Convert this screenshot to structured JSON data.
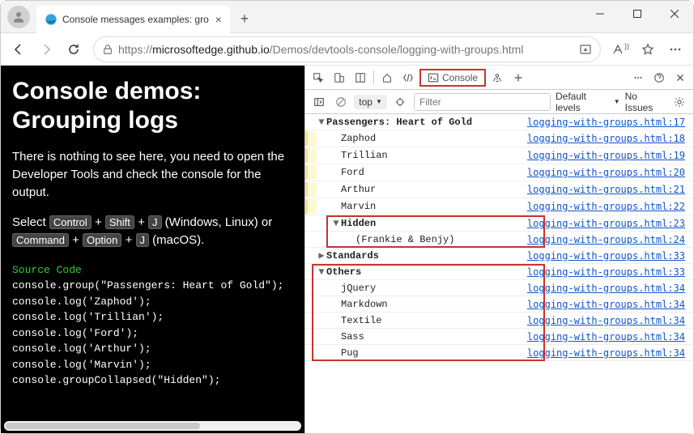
{
  "tab": {
    "title": "Console messages examples: gro"
  },
  "url": {
    "prefix": "https://",
    "host": "microsoftedge.github.io",
    "path": "/Demos/devtools-console/logging-with-groups.html"
  },
  "page": {
    "heading": "Console demos: Grouping logs",
    "p1": "There is nothing to see here, you need to open the Developer Tools and check the console for the output.",
    "p2a": "Select ",
    "p2b": " (Windows, Linux) or ",
    "p2c": " (macOS).",
    "k1": "Control",
    "k2": "Shift",
    "k3": "J",
    "k4": "Command",
    "k5": "Option",
    "k6": "J",
    "plus": "+",
    "srcLabel": "Source Code",
    "code": [
      "console.group(\"Passengers: Heart of Gold\");",
      "console.log('Zaphod');",
      "console.log('Trillian');",
      "console.log('Ford');",
      "console.log('Arthur');",
      "console.log('Marvin');",
      "console.groupCollapsed(\"Hidden\");"
    ]
  },
  "devtools": {
    "consoleTab": "Console",
    "context": "top",
    "filterPlaceholder": "Filter",
    "levels": "Default levels",
    "noIssues": "No Issues"
  },
  "logs": [
    {
      "type": "group",
      "expanded": true,
      "indent": 0,
      "text": "Passengers: Heart of Gold",
      "link": "logging-with-groups.html:17",
      "warn": false,
      "red": false
    },
    {
      "type": "log",
      "indent": 1,
      "text": "Zaphod",
      "link": "logging-with-groups.html:18",
      "warn": true
    },
    {
      "type": "log",
      "indent": 1,
      "text": "Trillian",
      "link": "logging-with-groups.html:19",
      "warn": true
    },
    {
      "type": "log",
      "indent": 1,
      "text": "Ford",
      "link": "logging-with-groups.html:20",
      "warn": true
    },
    {
      "type": "log",
      "indent": 1,
      "text": "Arthur",
      "link": "logging-with-groups.html:21",
      "warn": true
    },
    {
      "type": "log",
      "indent": 1,
      "text": "Marvin",
      "link": "logging-with-groups.html:22",
      "warn": true
    },
    {
      "type": "group",
      "expanded": true,
      "indent": 1,
      "text": "Hidden",
      "link": "logging-with-groups.html:23",
      "warn": false,
      "red": true
    },
    {
      "type": "log",
      "indent": 2,
      "text": "(Frankie & Benjy)",
      "link": "logging-with-groups.html:24",
      "warn": false,
      "red": true
    },
    {
      "type": "group",
      "expanded": false,
      "indent": 0,
      "text": "Standards",
      "link": "logging-with-groups.html:33",
      "warn": false,
      "red": false
    },
    {
      "type": "group",
      "expanded": true,
      "indent": 0,
      "text": "Others",
      "link": "logging-with-groups.html:33",
      "warn": false,
      "red": true
    },
    {
      "type": "log",
      "indent": 1,
      "text": "jQuery",
      "link": "logging-with-groups.html:34",
      "warn": false,
      "red": true
    },
    {
      "type": "log",
      "indent": 1,
      "text": "Markdown",
      "link": "logging-with-groups.html:34",
      "warn": false,
      "red": true
    },
    {
      "type": "log",
      "indent": 1,
      "text": "Textile",
      "link": "logging-with-groups.html:34",
      "warn": false,
      "red": true
    },
    {
      "type": "log",
      "indent": 1,
      "text": "Sass",
      "link": "logging-with-groups.html:34",
      "warn": false,
      "red": true
    },
    {
      "type": "log",
      "indent": 1,
      "text": "Pug",
      "link": "logging-with-groups.html:34",
      "warn": false,
      "red": true
    }
  ]
}
